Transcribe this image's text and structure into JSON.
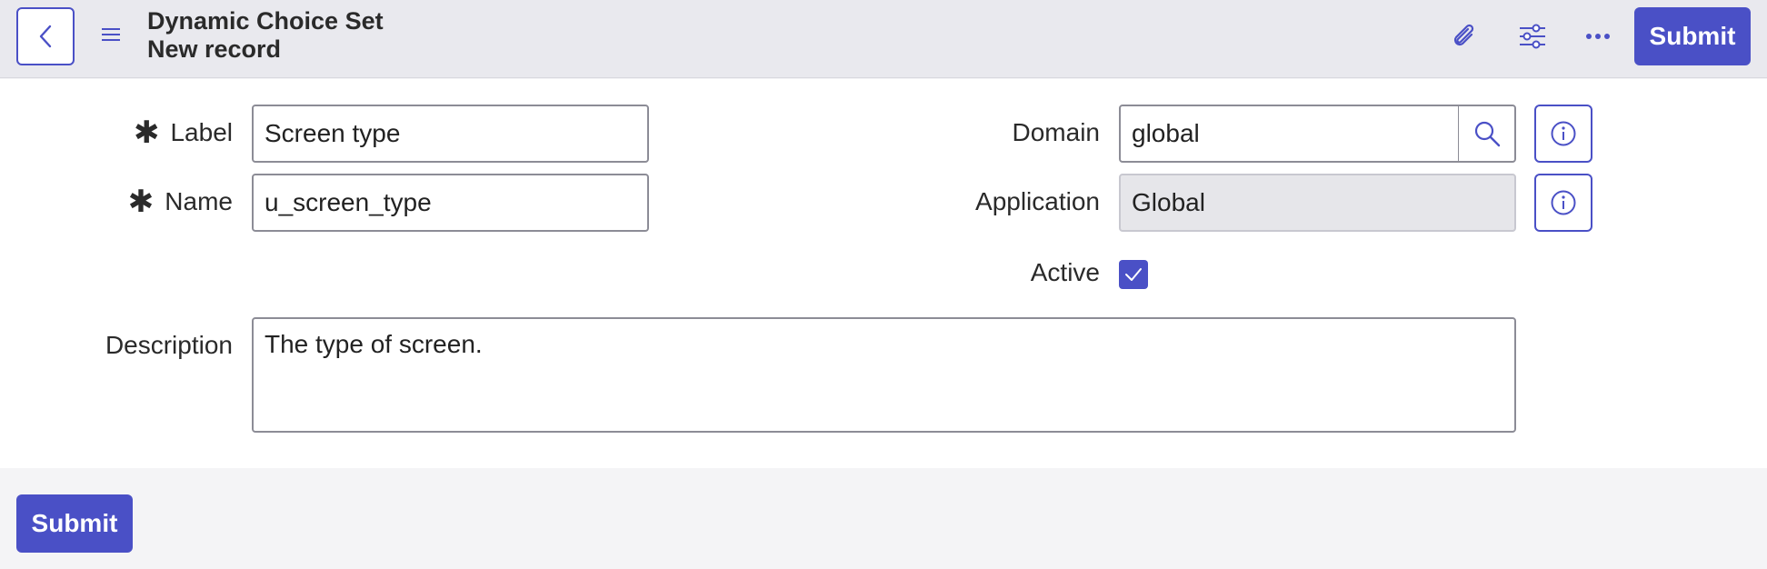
{
  "header": {
    "title": "Dynamic Choice Set",
    "subtitle": "New record",
    "submit_label": "Submit"
  },
  "form": {
    "label": {
      "label": "Label",
      "value": "Screen type"
    },
    "name": {
      "label": "Name",
      "value": "u_screen_type"
    },
    "domain": {
      "label": "Domain",
      "value": "global"
    },
    "application": {
      "label": "Application",
      "value": "Global"
    },
    "active": {
      "label": "Active",
      "checked": true
    },
    "description": {
      "label": "Description",
      "value": "The type of screen."
    },
    "required_marker": "✱"
  },
  "footer": {
    "submit_label": "Submit"
  },
  "colors": {
    "accent": "#4a50c6",
    "header_bg": "#e9e9ee"
  }
}
